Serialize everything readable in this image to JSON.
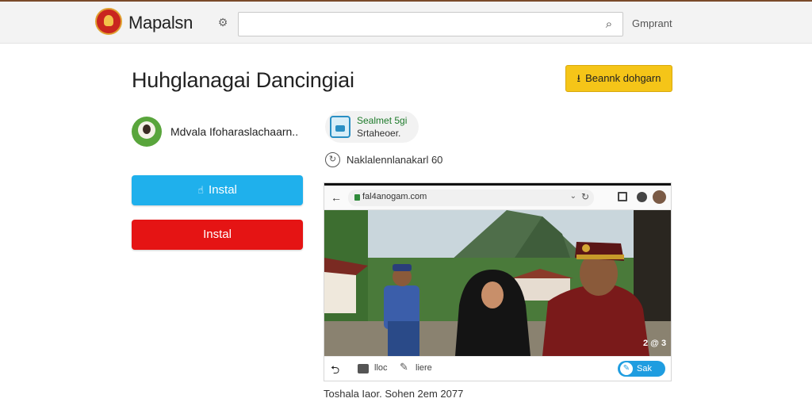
{
  "header": {
    "brand": "Mapalsn",
    "settings_icon": "gear-icon",
    "search_value": "",
    "search_icon": "search-icon",
    "link": "Gmprant"
  },
  "main": {
    "title": "Huhglanagai Dancingiai",
    "download_button": "Beannk dohgarn",
    "author": {
      "name": "Mdvala Ifoharaslachaarn..",
      "avatar_color": "#59a53c"
    },
    "install_primary": "Instal",
    "install_secondary": "Instal"
  },
  "app_card": {
    "title": "Sealmet 5gi",
    "subtitle": "Srtaheoer."
  },
  "meta": {
    "text": "Naklalennlanakarl 60"
  },
  "browser": {
    "url": "fal4anogam.com",
    "footer_label_1": "lloc",
    "footer_label_2": "liere",
    "footer_button": "Sak",
    "photo_watermark": "2 @ 3"
  },
  "caption": "Toshala Iaor. Sohen 2em 2077",
  "colors": {
    "primary_button": "#1fb0ec",
    "danger_button": "#e51414",
    "download_button": "#f5c518"
  }
}
